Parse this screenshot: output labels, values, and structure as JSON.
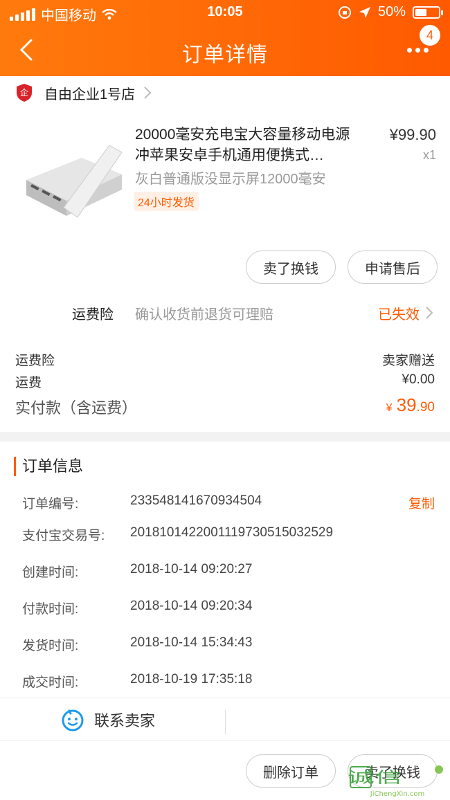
{
  "status_bar": {
    "carrier": "中国移动",
    "time": "10:05",
    "battery": "50%",
    "battery_level": 0.5
  },
  "nav": {
    "title": "订单详情",
    "badge": "4"
  },
  "shop": {
    "name": "自由企业1号店",
    "icon_text": "企"
  },
  "product": {
    "title": "20000毫安充电宝大容量移动电源冲苹果安卓手机通用便携式…",
    "price": "¥99.90",
    "qty": "x1",
    "sku": "灰白普通版没显示屏12000毫安",
    "tag": "24小时发货"
  },
  "actions": {
    "sell": "卖了换钱",
    "after_sale": "申请售后"
  },
  "insurance": {
    "label": "运费险",
    "desc": "确认收货前退货可理赔",
    "status": "已失效"
  },
  "fees": {
    "ins_label": "运费险",
    "ins_value": "卖家赠送",
    "ship_label": "运费",
    "ship_value": "¥0.00",
    "pay_label": "实付款（含运费）",
    "pay_currency": "¥",
    "pay_int": "39",
    "pay_dec": ".90"
  },
  "order_info": {
    "heading": "订单信息",
    "copy": "复制",
    "rows": [
      {
        "label": "订单编号:",
        "value": "233548141670934504"
      },
      {
        "label": "支付宝交易号:",
        "value": "2018101422001119730515032529"
      },
      {
        "label": "创建时间:",
        "value": "2018-10-14 09:20:27"
      },
      {
        "label": "付款时间:",
        "value": "2018-10-14 09:20:34"
      },
      {
        "label": "发货时间:",
        "value": "2018-10-14 15:34:43"
      },
      {
        "label": "成交时间:",
        "value": "2018-10-19 17:35:18"
      }
    ]
  },
  "bottom": {
    "contact": "联系卖家",
    "delete": "删除订单",
    "sell": "卖了换钱"
  },
  "watermark": {
    "text": "JiChengXin.com",
    "glyphs": "集诚信"
  },
  "colors": {
    "accent": "#ff5a00",
    "header_start": "#ff7a0d",
    "header_end": "#ff5a00",
    "contact_icon": "#1e9be9"
  }
}
